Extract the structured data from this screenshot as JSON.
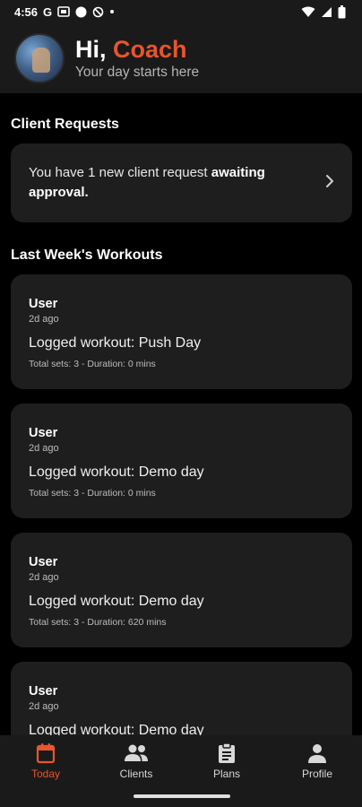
{
  "status_bar": {
    "time": "4:56",
    "g_letter": "G"
  },
  "header": {
    "hi": "Hi,",
    "name": "Coach",
    "subtitle": "Your day starts here"
  },
  "client_requests": {
    "title": "Client Requests",
    "text_prefix": "You have 1 new client request ",
    "text_bold": "awaiting approval."
  },
  "workouts": {
    "title": "Last Week's Workouts",
    "items": [
      {
        "user": "User",
        "time": "2d ago",
        "title": "Logged workout: Push Day",
        "meta": "Total sets: 3 - Duration: 0 mins"
      },
      {
        "user": "User",
        "time": "2d ago",
        "title": "Logged workout: Demo day",
        "meta": "Total sets: 3 - Duration: 0 mins"
      },
      {
        "user": "User",
        "time": "2d ago",
        "title": "Logged workout: Demo day",
        "meta": "Total sets: 3 - Duration: 620 mins"
      },
      {
        "user": "User",
        "time": "2d ago",
        "title": "Logged workout: Demo day",
        "meta": ""
      }
    ]
  },
  "nav": {
    "today": "Today",
    "clients": "Clients",
    "plans": "Plans",
    "profile": "Profile",
    "active": "today"
  },
  "colors": {
    "accent": "#e8552e",
    "card": "#1e1e1e",
    "background": "#000000",
    "bar": "#1a1a1a"
  }
}
